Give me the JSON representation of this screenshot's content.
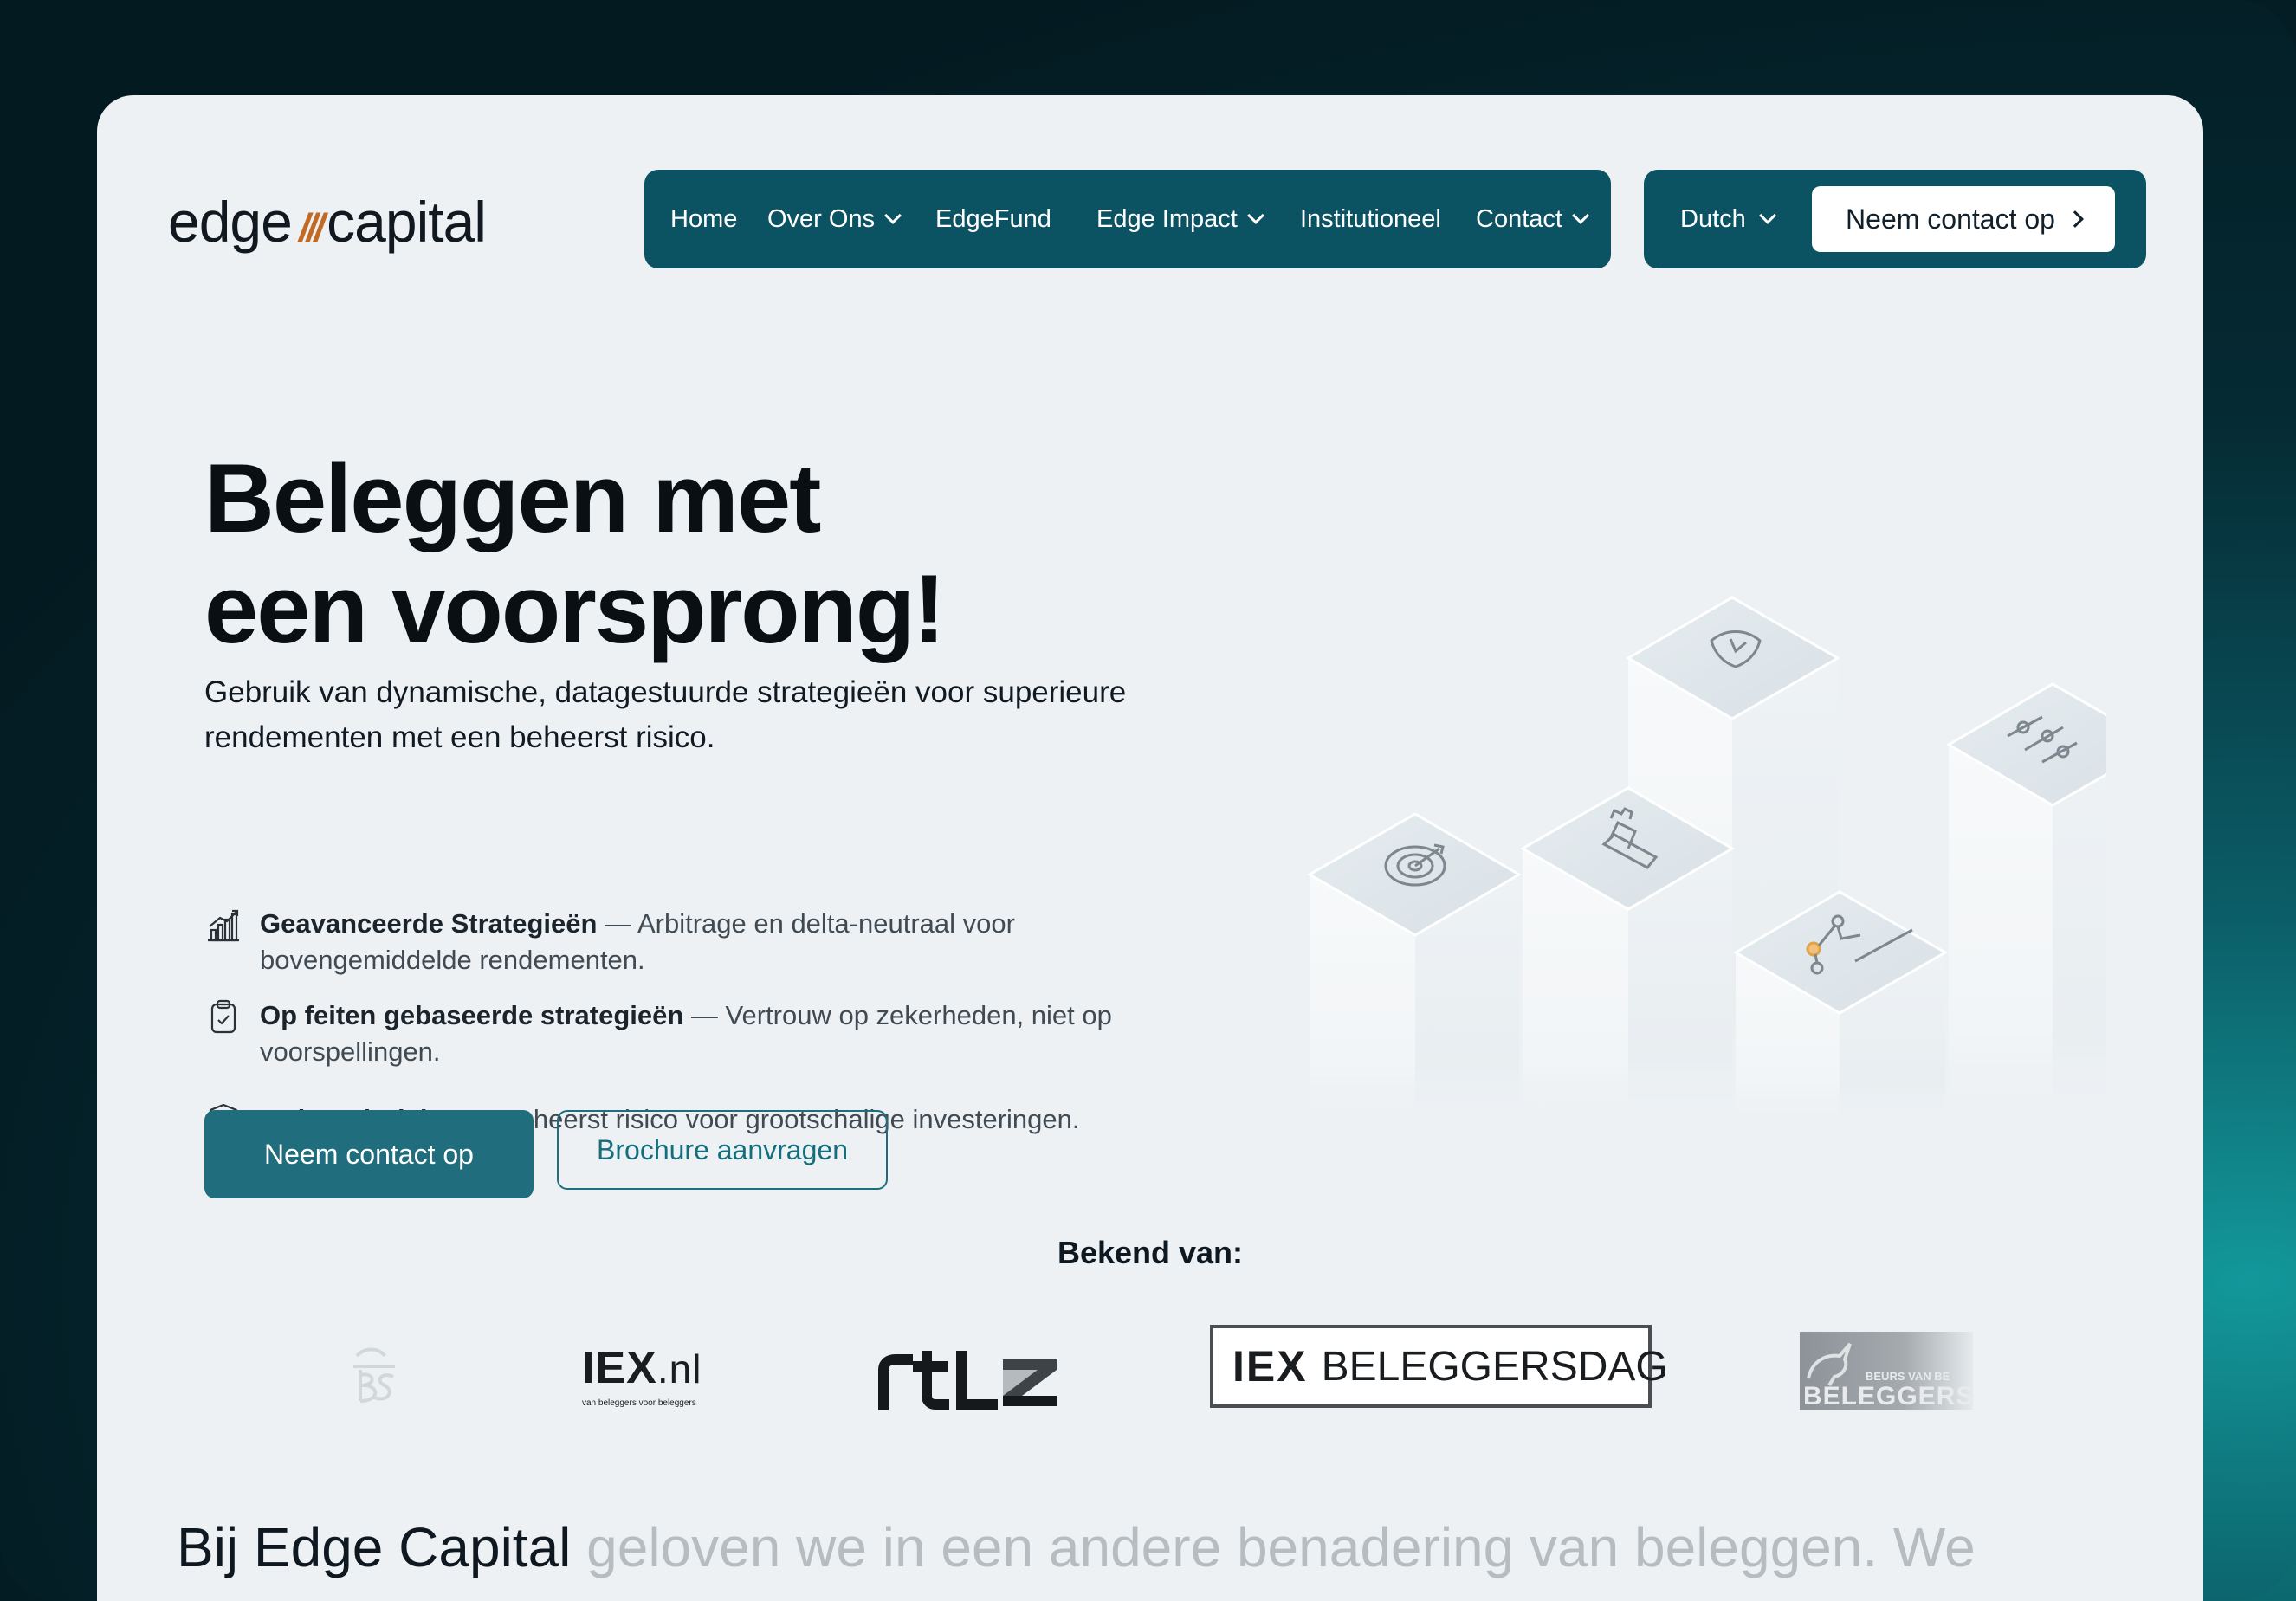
{
  "brand": {
    "logo_left": "edge",
    "logo_slashes": "///",
    "logo_right": "capital",
    "accent_color": "#c26a24",
    "primary_color": "#0b5263"
  },
  "nav": {
    "items": [
      {
        "label": "Home",
        "has_dropdown": false
      },
      {
        "label": "Over Ons",
        "has_dropdown": true
      },
      {
        "label": "EdgeFund",
        "has_dropdown": false
      },
      {
        "label": "Edge Impact",
        "has_dropdown": true
      },
      {
        "label": "Institutioneel",
        "has_dropdown": false
      },
      {
        "label": "Contact",
        "has_dropdown": true
      }
    ],
    "language": "Dutch",
    "cta": "Neem contact op"
  },
  "hero": {
    "title_line1": "Beleggen met",
    "title_line2": "een voorsprong!",
    "subtitle": "Gebruik van dynamische, datagestuurde strategieën voor superieure rendementen met een beheerst risico.",
    "features": [
      {
        "icon": "chart-bars-icon",
        "title": "Geavanceerde Strategieën",
        "text": " — Arbitrage en delta-neutraal voor bovengemiddelde rendementen."
      },
      {
        "icon": "clipboard-check-icon",
        "title": "Op feiten gebaseerde strategieën",
        "text": " — Vertrouw op zekerheden, niet op voorspellingen."
      },
      {
        "icon": "shield-check-icon",
        "title": "Beheerd Risico",
        "text": " — Beheerst risico voor grootschalige investeringen."
      }
    ],
    "primary_button": "Neem contact op",
    "secondary_button": "Brochure aanvragen"
  },
  "press": {
    "heading": "Bekend van:",
    "logos": [
      {
        "name": "bs-logo",
        "text": "BS"
      },
      {
        "name": "iex-nl-logo",
        "text_main": "IEX",
        "text_suffix": ".nl",
        "tagline": "van beleggers voor beleggers"
      },
      {
        "name": "rtlz-logo",
        "text": "rtlz"
      },
      {
        "name": "iex-beleggersdag-logo",
        "text_main": "IEX",
        "text_suffix": "BELEGGERSDAG"
      },
      {
        "name": "beurs-van-beleggers-logo",
        "text_top": "BEURS VAN BE",
        "text_main": "BELEGGERSF"
      }
    ]
  },
  "intro": {
    "strong": "Bij Edge Capital",
    "rest": " geloven we in een andere benadering van beleggen. We"
  }
}
